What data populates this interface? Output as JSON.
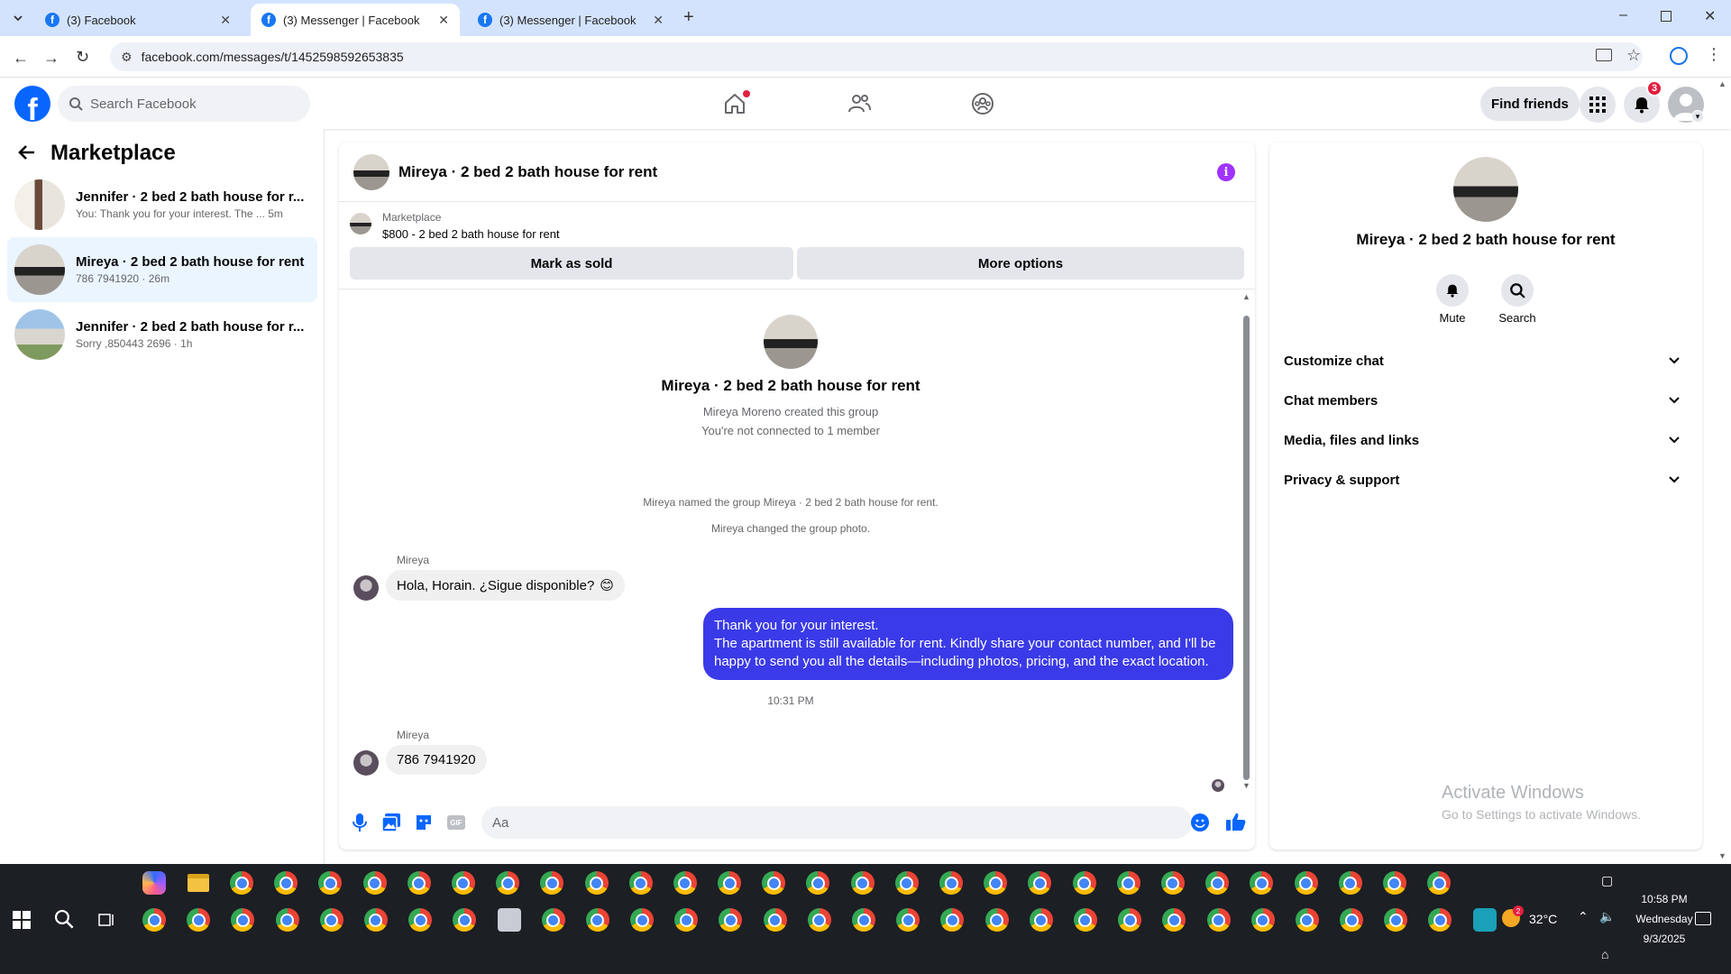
{
  "browser": {
    "tabs": [
      {
        "title": "(3) Facebook",
        "active": false
      },
      {
        "title": "(3) Messenger | Facebook",
        "active": true
      },
      {
        "title": "(3) Messenger | Facebook",
        "active": false
      }
    ],
    "url": "facebook.com/messages/t/1452598592653835"
  },
  "header": {
    "logo_letter": "f",
    "search_placeholder": "Search Facebook",
    "find_friends": "Find friends",
    "notification_count": "3"
  },
  "sidebar": {
    "title": "Marketplace",
    "conversations": [
      {
        "title": "Jennifer · 2 bed 2 bath house for r...",
        "preview": "You: Thank you for your interest. The ...",
        "time": "5m",
        "selected": false
      },
      {
        "title": "Mireya · 2 bed 2 bath house for rent",
        "preview": "786 7941920",
        "time": "26m",
        "selected": true
      },
      {
        "title": "Jennifer · 2 bed 2 bath house for r...",
        "preview": "Sorry ,850443 2696",
        "time": "1h",
        "selected": false
      }
    ]
  },
  "chat": {
    "title": "Mireya · 2 bed 2 bath house for rent",
    "listing": {
      "category": "Marketplace",
      "price_line": "$800 - 2 bed 2 bath house for rent"
    },
    "buttons": {
      "mark_sold": "Mark as sold",
      "more_options": "More options"
    },
    "intro": {
      "title": "Mireya · 2 bed 2 bath house for rent",
      "created": "Mireya Moreno created this group",
      "not_connected": "You're not connected to 1 member"
    },
    "system_messages": [
      "Mireya named the group Mireya · 2 bed 2 bath house for rent.",
      "Mireya changed the group photo."
    ],
    "messages": [
      {
        "sender": "Mireya",
        "text": "Hola, Horain. ¿Sigue disponible?",
        "emoji": "😊"
      },
      {
        "sender": "You",
        "lines": [
          "Thank you for your interest.",
          "The apartment is still available for rent. Kindly share your contact number, and I'll be",
          "happy to send you all the details—including photos, pricing, and the exact location."
        ]
      },
      {
        "sender": "Mireya",
        "text": "786 7941920"
      }
    ],
    "timestamp": "10:31 PM",
    "composer_placeholder": "Aa"
  },
  "info": {
    "title": "Mireya · 2 bed 2 bath house for rent",
    "actions": [
      "Mute",
      "Search"
    ],
    "rows": [
      "Customize chat",
      "Chat members",
      "Media, files and links",
      "Privacy & support"
    ]
  },
  "watermark": {
    "line1": "Activate Windows",
    "line2": "Go to Settings to activate Windows."
  },
  "taskbar": {
    "weather_badge": "2",
    "temperature": "32°C",
    "time": "10:58 PM",
    "day": "Wednesday",
    "date": "9/3/2025"
  },
  "colors": {
    "fb_blue": "#0866ff",
    "outgoing_bubble": "#3a3ae8",
    "selected_row": "#ebf5ff",
    "badge_red": "#e41e3f"
  }
}
